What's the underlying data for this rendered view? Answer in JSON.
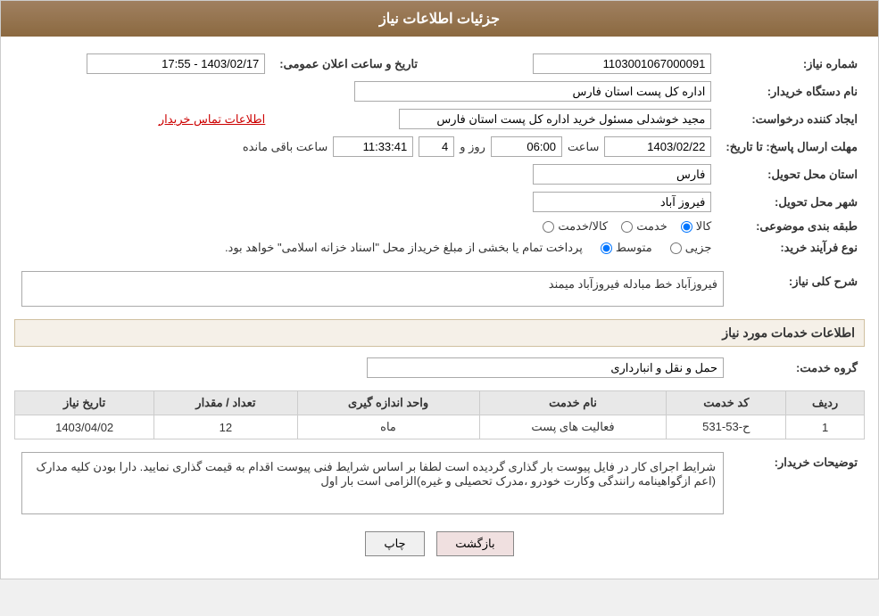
{
  "header": {
    "title": "جزئیات اطلاعات نیاز"
  },
  "fields": {
    "need_number_label": "شماره نیاز:",
    "need_number_value": "1103001067000091",
    "buyer_org_label": "نام دستگاه خریدار:",
    "buyer_org_value": "اداره کل پست استان فارس",
    "announcement_date_label": "تاریخ و ساعت اعلان عمومی:",
    "announcement_date_value": "1403/02/17 - 17:55",
    "creator_label": "ایجاد کننده درخواست:",
    "creator_value": "مجید خوشدلی مسئول خرید اداره کل پست استان فارس",
    "contact_link": "اطلاعات تماس خریدار",
    "response_deadline_label": "مهلت ارسال پاسخ: تا تاریخ:",
    "response_date": "1403/02/22",
    "response_time_label": "ساعت",
    "response_time": "06:00",
    "response_days_label": "روز و",
    "response_days": "4",
    "response_remaining_label": "ساعت باقی مانده",
    "response_remaining": "11:33:41",
    "delivery_province_label": "استان محل تحویل:",
    "delivery_province": "فارس",
    "delivery_city_label": "شهر محل تحویل:",
    "delivery_city": "فیروز آباد",
    "category_label": "طبقه بندی موضوعی:",
    "category_options": [
      "کالا",
      "خدمت",
      "کالا/خدمت"
    ],
    "category_selected": "کالا",
    "purchase_type_label": "نوع فرآیند خرید:",
    "purchase_types": [
      "جزیی",
      "متوسط"
    ],
    "purchase_type_selected": "متوسط",
    "purchase_type_desc": "پرداخت تمام یا بخشی از مبلغ خریداز محل \"اسناد خزانه اسلامی\" خواهد بود.",
    "need_description_label": "شرح کلی نیاز:",
    "need_description": "فیروزآباد خط مبادله فیروزآباد میمند",
    "services_section_label": "اطلاعات خدمات مورد نیاز",
    "service_group_label": "گروه خدمت:",
    "service_group_value": "حمل و نقل و انبارداری",
    "table_headers": {
      "row_num": "ردیف",
      "service_code": "کد خدمت",
      "service_name": "نام خدمت",
      "unit": "واحد اندازه گیری",
      "quantity": "تعداد / مقدار",
      "date": "تاریخ نیاز"
    },
    "table_rows": [
      {
        "row_num": "1",
        "service_code": "ح-53-531",
        "service_name": "فعالیت های پست",
        "unit": "ماه",
        "quantity": "12",
        "date": "1403/04/02"
      }
    ],
    "buyer_notes_label": "توضیحات خریدار:",
    "buyer_notes": "شرایط اجرای کار در فایل پیوست بار گذاری گردیده است لطفا بر اساس شرایط فنی پیوست اقدام به قیمت گذاری نمایید.\nدارا بودن کلیه مدارک (اعم ازگواهینامه رانندگی وکارت خودرو ،مدرک تحصیلی و غیره)الزامی است\nبار اول"
  },
  "buttons": {
    "print_label": "چاپ",
    "back_label": "بازگشت"
  },
  "colors": {
    "header_bg": "#8b6940",
    "section_bg": "#f5f0e8"
  }
}
